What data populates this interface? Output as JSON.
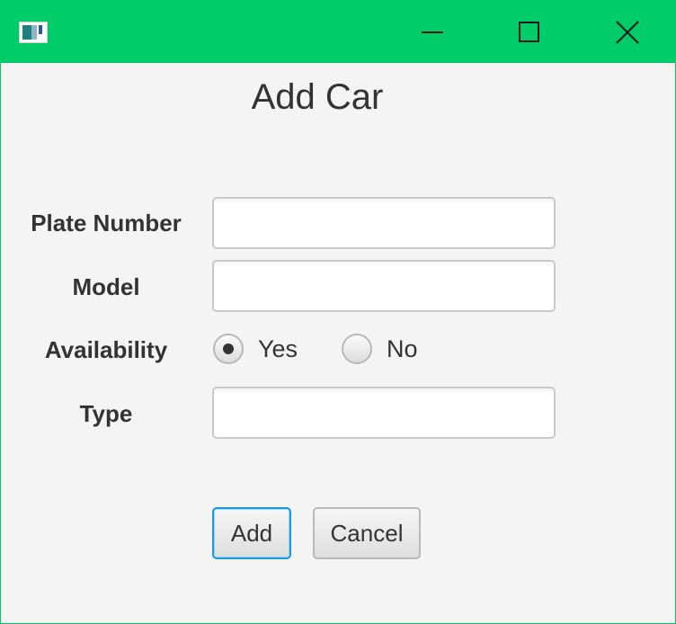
{
  "window": {
    "title": "",
    "accent_color": "#00cc6a",
    "controls": {
      "minimize_icon": "minimize-icon",
      "maximize_icon": "maximize-icon",
      "close_icon": "close-icon"
    }
  },
  "form": {
    "heading": "Add Car",
    "fields": {
      "plate_number": {
        "label": "Plate Number",
        "value": ""
      },
      "model": {
        "label": "Model",
        "value": ""
      },
      "type": {
        "label": "Type",
        "value": ""
      }
    },
    "availability": {
      "label": "Availability",
      "options": [
        "Yes",
        "No"
      ],
      "selected": "Yes"
    },
    "buttons": {
      "add": "Add",
      "cancel": "Cancel"
    }
  }
}
